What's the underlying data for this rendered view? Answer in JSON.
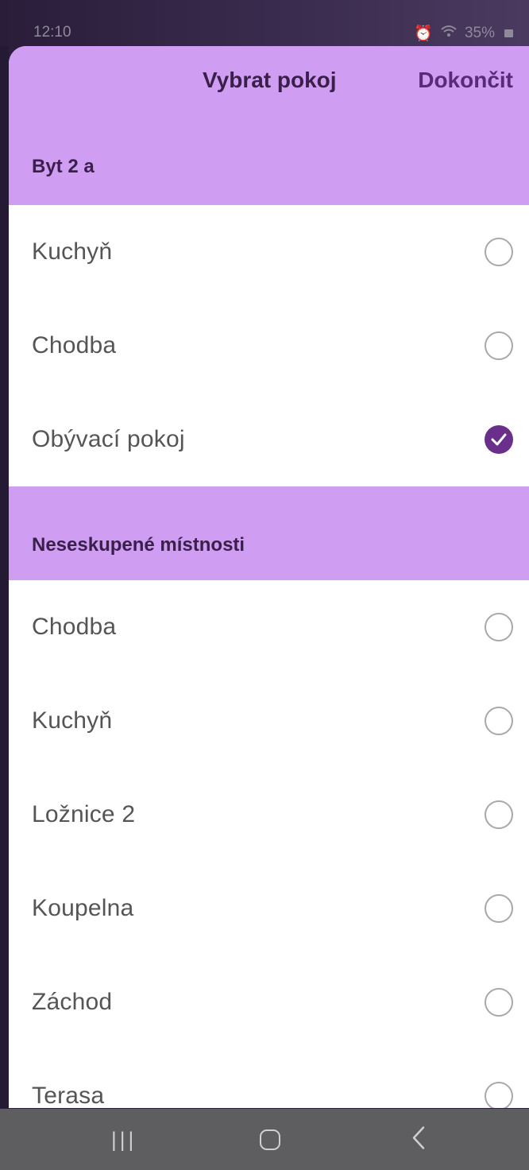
{
  "status_bar": {
    "time": "12:10",
    "battery": "35%"
  },
  "header": {
    "title": "Vybrat pokoj",
    "done_label": "Dokončit"
  },
  "groups": [
    {
      "name": "Byt 2 a",
      "rooms": [
        {
          "label": "Kuchyň",
          "selected": false
        },
        {
          "label": "Chodba",
          "selected": false
        },
        {
          "label": "Obývací pokoj",
          "selected": true
        }
      ]
    },
    {
      "name": "Neseskupené místnosti",
      "rooms": [
        {
          "label": "Chodba",
          "selected": false
        },
        {
          "label": "Kuchyň",
          "selected": false
        },
        {
          "label": "Ložnice 2",
          "selected": false
        },
        {
          "label": "Koupelna",
          "selected": false
        },
        {
          "label": "Záchod",
          "selected": false
        },
        {
          "label": "Terasa",
          "selected": false
        }
      ]
    }
  ],
  "colors": {
    "accent": "#6a2f8a",
    "header_bg": "#cf9df1"
  }
}
